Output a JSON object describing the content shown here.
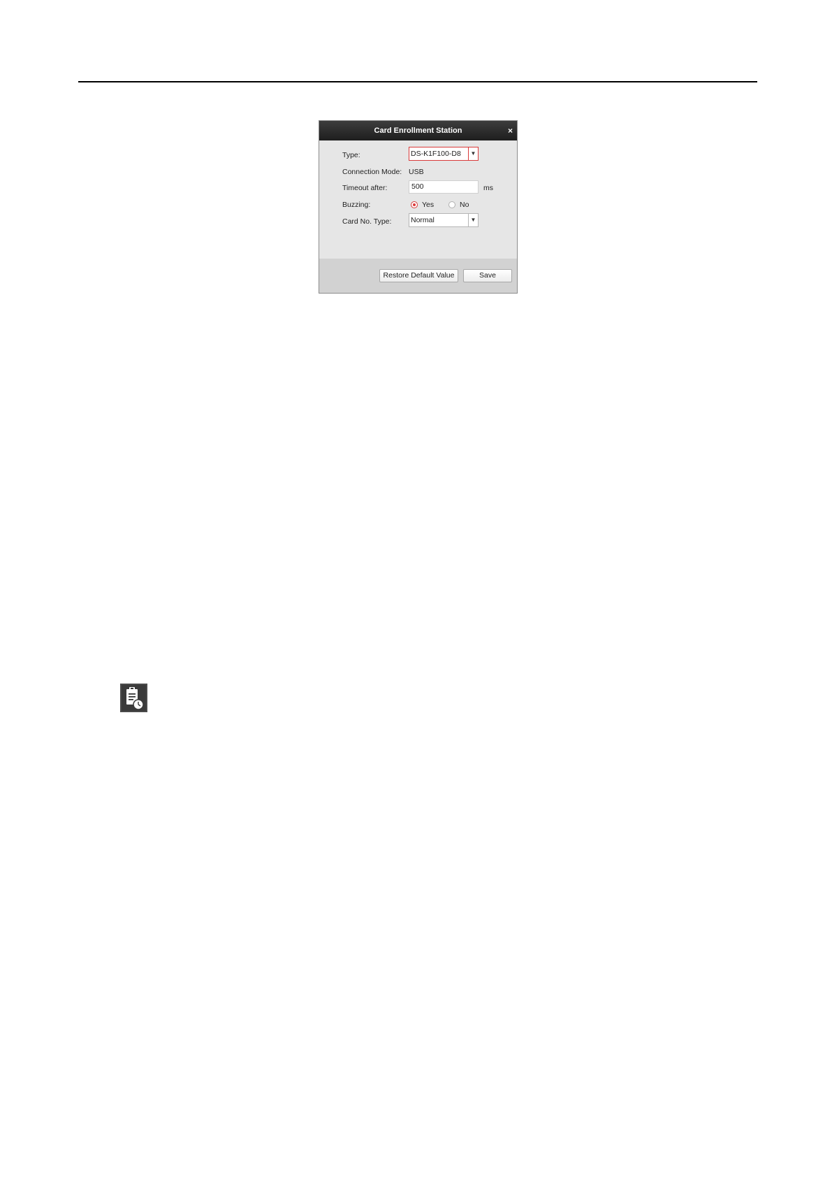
{
  "dialog": {
    "title": "Card Enrollment Station",
    "close_glyph": "×",
    "fields": {
      "type_label": "Type:",
      "type_value": "DS-K1F100-D8",
      "connection_mode_label": "Connection Mode:",
      "connection_mode_value": "USB",
      "timeout_label": "Timeout after:",
      "timeout_value": "500",
      "timeout_unit": "ms",
      "buzzing_label": "Buzzing:",
      "buzzing_yes": "Yes",
      "buzzing_no": "No",
      "buzzing_selected": "Yes",
      "card_no_type_label": "Card No. Type:",
      "card_no_type_value": "Normal"
    },
    "buttons": {
      "restore_default": "Restore Default Value",
      "save": "Save"
    },
    "colors": {
      "titlebar": "#1e1e1e",
      "accent": "#d93a3a",
      "body": "#e6e6e6",
      "footer": "#d2d2d2"
    }
  },
  "icons": {
    "note": "note-clipboard-clock-icon",
    "dropdown": "chevron-down-icon",
    "close": "close-icon"
  }
}
